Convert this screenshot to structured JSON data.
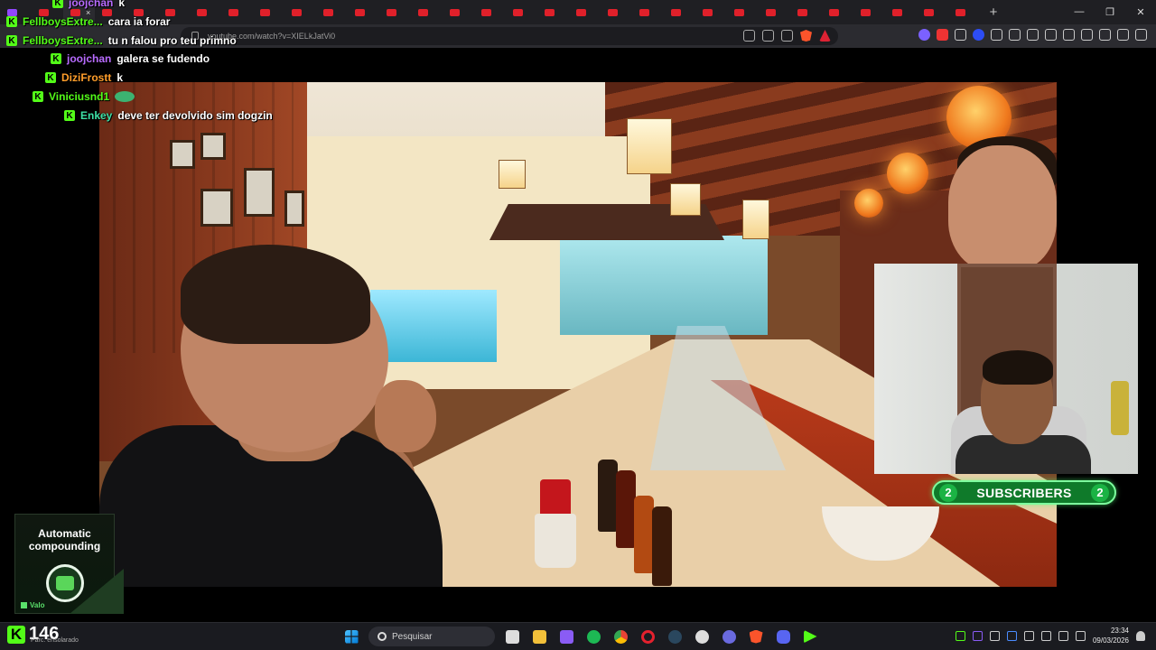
{
  "browser": {
    "url": "youtube.com/watch?v=XIELkJatVi0",
    "active_tab_close": "×",
    "new_tab": "+",
    "tab_count_yt": 25,
    "window_controls": {
      "minimize": "—",
      "restore": "❐",
      "close": "✕"
    }
  },
  "chat": {
    "badge_letter": "K",
    "messages": [
      {
        "user": "joojchan",
        "text": "k",
        "user_color": "purple"
      },
      {
        "user": "FellboysExtre...",
        "text": "cara ia forar",
        "user_color": "green"
      },
      {
        "user": "FellboysExtre...",
        "text": "tu n falou pro teu primno",
        "user_color": "green"
      },
      {
        "user": "joojchan",
        "text": "galera se fudendo",
        "user_color": "purple"
      },
      {
        "user": "DiziFrostt",
        "text": "k",
        "user_color": "orange"
      },
      {
        "user": "Viniciusnd1",
        "text": "",
        "user_color": "green",
        "emote": "frog-emote"
      },
      {
        "user": "Enkey",
        "text": "deve ter devolvido sim dogzin",
        "user_color": "teal"
      }
    ]
  },
  "subscribers": {
    "left_count": "2",
    "label": "SUBSCRIBERS",
    "right_count": "2"
  },
  "ad_widget": {
    "line1": "Automatic",
    "line2": "compounding",
    "brand": "Valo"
  },
  "viewer_count": {
    "badge": "K",
    "count": "146"
  },
  "taskbar": {
    "weather": "Parc. ensolarado",
    "search_placeholder": "Pesquisar",
    "time": "23:34",
    "date": "09/03/2026"
  },
  "colors": {
    "kick_green": "#53fc18",
    "subs_pill": "#0f7a2a",
    "taskbar_bg": "#1a1b20",
    "browser_bg": "#2b2b30"
  }
}
